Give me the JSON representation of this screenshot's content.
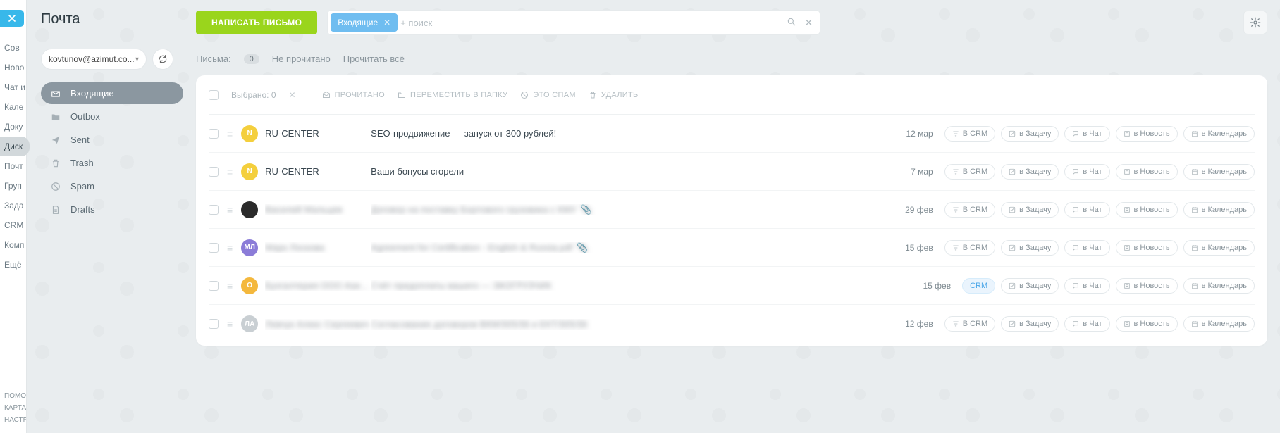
{
  "app_rail": {
    "items": [
      "Сов",
      "Ново",
      "Чат и",
      "Кале",
      "Доку",
      "Диск",
      "Почт",
      "Груп",
      "Зада",
      "CRM",
      "Комп",
      "Ещё"
    ],
    "active_index": 5,
    "bottom": [
      "ПОМО",
      "КАРТА",
      "НАСТР"
    ]
  },
  "sidebar": {
    "title": "Почта",
    "account": "kovtunov@azimut.co...",
    "folders": [
      {
        "icon": "inbox",
        "label": "Входящие"
      },
      {
        "icon": "folder",
        "label": "Outbox"
      },
      {
        "icon": "sent",
        "label": "Sent"
      },
      {
        "icon": "trash",
        "label": "Trash"
      },
      {
        "icon": "spam",
        "label": "Spam"
      },
      {
        "icon": "drafts",
        "label": "Drafts"
      }
    ],
    "active_folder": 0
  },
  "topbar": {
    "compose": "НАПИСАТЬ ПИСЬМО",
    "search_tag": "Входящие",
    "search_placeholder": "+ поиск"
  },
  "filter": {
    "label": "Письма:",
    "count": "0",
    "unread": "Не прочитано",
    "read_all": "Прочитать всё"
  },
  "bulk": {
    "selected_label": "Выбрано:",
    "selected_count": "0",
    "read": "ПРОЧИТАНО",
    "move": "ПЕРЕМЕСТИТЬ В ПАПКУ",
    "spam": "ЭТО СПАМ",
    "delete": "УДАЛИТЬ"
  },
  "action_pills": {
    "crm": "В CRM",
    "crm_short": "CRM",
    "task": "в Задачу",
    "chat": "в Чат",
    "news": "в Новость",
    "calendar": "в Календарь"
  },
  "avatar_colors": {
    "yellow": "#f4cf3d",
    "dark": "#2b2b2b",
    "purple": "#8b7cd8",
    "orange": "#f4b83d",
    "grey": "#c9cfd3"
  },
  "messages": [
    {
      "avatar": "N",
      "avatar_color": "yellow",
      "sender": "RU-CENTER",
      "subject": "SEO-продвижение — запуск от 300 рублей!",
      "date": "12 мар",
      "blur": false,
      "attach": false,
      "crm_active": false
    },
    {
      "avatar": "N",
      "avatar_color": "yellow",
      "sender": "RU-CENTER",
      "subject": "Ваши бонусы сгорели",
      "date": "7 мар",
      "blur": false,
      "attach": false,
      "crm_active": false
    },
    {
      "avatar": "",
      "avatar_color": "dark",
      "sender": "Василий Мальцев",
      "subject": "Договор на поставку Бортового грузовика с КМУ",
      "date": "29 фев",
      "blur": true,
      "attach": true,
      "crm_active": false
    },
    {
      "avatar": "МЛ",
      "avatar_color": "purple",
      "sender": "Марк Лоскова",
      "subject": "Agreement for Certification - English & Russia.pdf",
      "date": "15 фев",
      "blur": true,
      "attach": true,
      "crm_active": false
    },
    {
      "avatar": "О",
      "avatar_color": "orange",
      "sender": "Бухгалтерия ООО Азимут",
      "subject": "Счёт предоплаты вашего — ЭКОГРУЗЧИК",
      "date": "15 фев",
      "blur": true,
      "attach": false,
      "crm_active": true
    },
    {
      "avatar": "ЛА",
      "avatar_color": "grey",
      "sender": "Левчук Алекс Сергеевич",
      "subject": "Согласование договоров ВКМ/305/36 и ЕКТ/305/36",
      "date": "12 фев",
      "blur": true,
      "attach": false,
      "crm_active": false
    }
  ]
}
